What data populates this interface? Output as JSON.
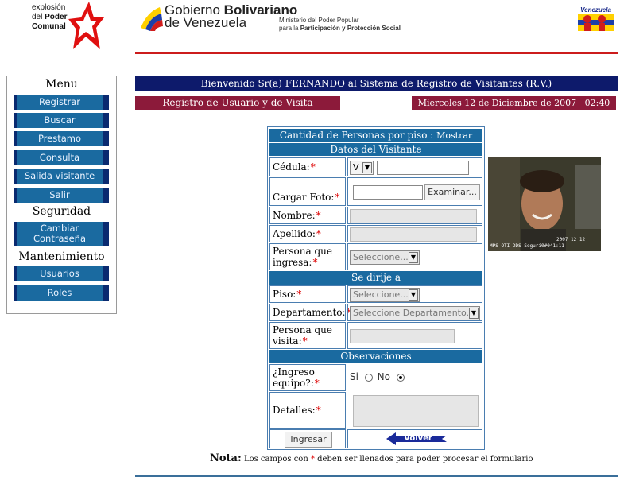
{
  "header": {
    "brand_left_line1": "explosión",
    "brand_left_line2_a": "del ",
    "brand_left_line2_b": "Poder",
    "brand_left_line3": "Comunal",
    "gov_title_a": "Gobierno ",
    "gov_title_b": "Bolivariano",
    "gov_title_line2": "de Venezuela",
    "ministry_line1": "Ministerio del Poder Popular",
    "ministry_line2_a": "para la ",
    "ministry_line2_b": "Participación y Protección Social",
    "right_logo_text": "Venezuela"
  },
  "menu": {
    "title": "Menu",
    "items": [
      "Registrar",
      "Buscar",
      "Prestamo",
      "Consulta",
      "Salida visitante",
      "Salir"
    ],
    "security_title": "Seguridad",
    "security_item_line1": "Cambiar",
    "security_item_line2": "Contraseña",
    "maintenance_title": "Mantenimiento",
    "maintenance_items": [
      "Usuarios",
      "Roles"
    ]
  },
  "banner": {
    "welcome": "Bienvenido Sr(a) FERNANDO al Sistema de Registro de Visitantes (R.V.)",
    "registration_title": "Registro de Usuario y de Visita",
    "date": "Miercoles 12 de Diciembre de 2007",
    "time": "02:40 pm"
  },
  "form": {
    "count_title_a": "Cantidad de Personas por piso : ",
    "count_title_link": "Mostrar",
    "visitor_section": "Datos del Visitante",
    "cedula_label": "Cédula:",
    "cedula_prefix": "V",
    "photo_label": "Cargar Foto:",
    "browse_button": "Examinar...",
    "nombre_label": "Nombre:",
    "apellido_label": "Apellido:",
    "persona_ingresa_label_1": "Persona que",
    "persona_ingresa_label_2": "ingresa:",
    "persona_ingresa_value": "Seleccione...",
    "goes_section": "Se dirije a",
    "piso_label": "Piso:",
    "piso_value": "Seleccione...",
    "departamento_label": "Departamento:",
    "departamento_value": "Seleccione Departamento...",
    "persona_visita_label_1": "Persona que",
    "persona_visita_label_2": "visita:",
    "observations_section": "Observaciones",
    "ingreso_label_1": "¿Ingreso",
    "ingreso_label_2": "equipo?:",
    "ingreso_si": "Si",
    "ingreso_no": "No",
    "detalles_label": "Detalles:",
    "submit_button": "Ingresar",
    "back_button": "Volver",
    "required_mark": "*"
  },
  "photo": {
    "caption_line1": "2007 12 12",
    "caption_line2": "MPS-OTI-DDS Seguri0#041:11"
  },
  "note": {
    "label": "Nota:",
    "text_a": " Los campos con ",
    "text_b": " deben ser llenados para poder procesar el formulario"
  },
  "colors": {
    "menu_button": "#1a6aa0",
    "welcome_bar": "#0d1a6b",
    "maroon_bar": "#8c1a3a",
    "required": "#dd0000",
    "header_line": "#cc1c1c"
  }
}
